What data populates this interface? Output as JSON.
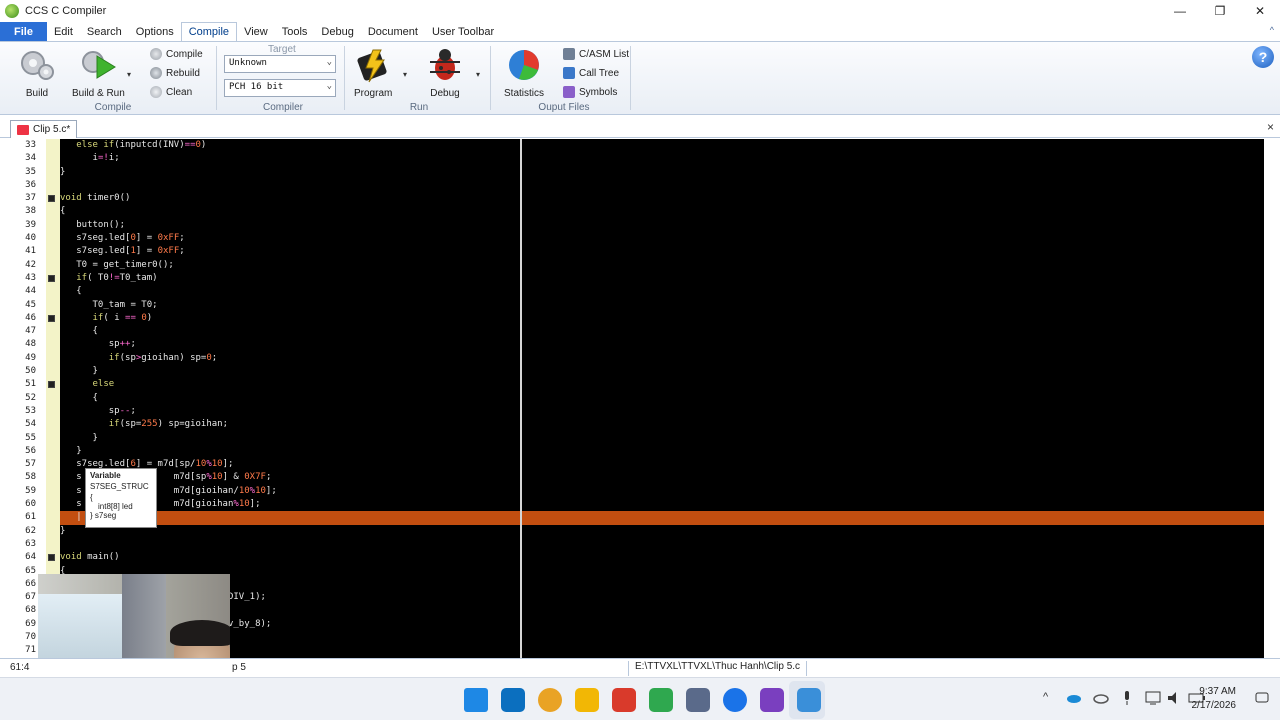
{
  "window": {
    "title": "CCS C Compiler",
    "minimize": "—",
    "maximize": "❐",
    "close": "✕"
  },
  "menu": {
    "tabs": [
      "File",
      "Edit",
      "Search",
      "Options",
      "Compile",
      "View",
      "Tools",
      "Debug",
      "Document",
      "User Toolbar"
    ],
    "active": "Compile",
    "help_collapse": "^"
  },
  "ribbon": {
    "compile_group": {
      "label": "Compile",
      "build": "Build",
      "build_run": "Build & Run",
      "compile": "Compile",
      "rebuild": "Rebuild",
      "clean": "Clean"
    },
    "compiler_group": {
      "label": "Compiler",
      "target_label": "Target",
      "target_value": "Unknown",
      "compiler_value": "PCH 16 bit"
    },
    "run_group": {
      "label": "Run",
      "program": "Program",
      "debug": "Debug"
    },
    "output_group": {
      "label": "Ouput Files",
      "statistics": "Statistics",
      "casm_list": "C/ASM List",
      "call_tree": "Call Tree",
      "symbols": "Symbols"
    },
    "help": "?"
  },
  "document": {
    "tab": "Clip 5.c*",
    "close": "×"
  },
  "editor": {
    "lines": [
      {
        "n": "33",
        "fold": false,
        "tokens": [
          [
            "kw",
            "   else "
          ],
          [
            "kw",
            "if"
          ],
          [
            "txt",
            "(inputcd(INV)"
          ],
          [
            "op",
            "=="
          ],
          [
            "num",
            "0"
          ],
          [
            "txt",
            ")"
          ]
        ]
      },
      {
        "n": "34",
        "fold": false,
        "tokens": [
          [
            "txt",
            "      i"
          ],
          [
            "op",
            "=!"
          ],
          [
            "txt",
            "i;"
          ]
        ]
      },
      {
        "n": "35",
        "fold": false,
        "tokens": [
          [
            "txt",
            "}"
          ]
        ]
      },
      {
        "n": "36",
        "fold": false,
        "tokens": []
      },
      {
        "n": "37",
        "fold": true,
        "tokens": [
          [
            "kw",
            "void "
          ],
          [
            "txt",
            "timer0()"
          ]
        ]
      },
      {
        "n": "38",
        "fold": false,
        "tokens": [
          [
            "txt",
            "{"
          ]
        ]
      },
      {
        "n": "39",
        "fold": false,
        "tokens": [
          [
            "txt",
            "   button();"
          ]
        ]
      },
      {
        "n": "40",
        "fold": false,
        "tokens": [
          [
            "txt",
            "   s7seg.led["
          ],
          [
            "num",
            "0"
          ],
          [
            "txt",
            "] = "
          ],
          [
            "num",
            "0xFF"
          ],
          [
            "txt",
            ";"
          ]
        ]
      },
      {
        "n": "41",
        "fold": false,
        "tokens": [
          [
            "txt",
            "   s7seg.led["
          ],
          [
            "num",
            "1"
          ],
          [
            "txt",
            "] = "
          ],
          [
            "num",
            "0xFF"
          ],
          [
            "txt",
            ";"
          ]
        ]
      },
      {
        "n": "42",
        "fold": false,
        "tokens": [
          [
            "txt",
            "   T0 = get_timer0();"
          ]
        ]
      },
      {
        "n": "43",
        "fold": true,
        "tokens": [
          [
            "kw",
            "   if"
          ],
          [
            "txt",
            "( T0"
          ],
          [
            "op",
            "!="
          ],
          [
            "txt",
            "T0_tam)"
          ]
        ]
      },
      {
        "n": "44",
        "fold": false,
        "tokens": [
          [
            "txt",
            "   {"
          ]
        ]
      },
      {
        "n": "45",
        "fold": false,
        "tokens": [
          [
            "txt",
            "      T0_tam = T0;"
          ]
        ]
      },
      {
        "n": "46",
        "fold": true,
        "tokens": [
          [
            "kw",
            "      if"
          ],
          [
            "txt",
            "( i "
          ],
          [
            "op",
            "=="
          ],
          [
            "txt",
            " "
          ],
          [
            "num",
            "0"
          ],
          [
            "txt",
            ")"
          ]
        ]
      },
      {
        "n": "47",
        "fold": false,
        "tokens": [
          [
            "txt",
            "      {"
          ]
        ]
      },
      {
        "n": "48",
        "fold": false,
        "tokens": [
          [
            "txt",
            "         sp"
          ],
          [
            "op",
            "++"
          ],
          [
            "txt",
            ";"
          ]
        ]
      },
      {
        "n": "49",
        "fold": false,
        "tokens": [
          [
            "kw",
            "         if"
          ],
          [
            "txt",
            "(sp"
          ],
          [
            "op",
            ">"
          ],
          [
            "txt",
            "gioihan) sp="
          ],
          [
            "num",
            "0"
          ],
          [
            "txt",
            ";"
          ]
        ]
      },
      {
        "n": "50",
        "fold": false,
        "tokens": [
          [
            "txt",
            "      }"
          ]
        ]
      },
      {
        "n": "51",
        "fold": true,
        "tokens": [
          [
            "kw",
            "      else"
          ]
        ]
      },
      {
        "n": "52",
        "fold": false,
        "tokens": [
          [
            "txt",
            "      {"
          ]
        ]
      },
      {
        "n": "53",
        "fold": false,
        "tokens": [
          [
            "txt",
            "         sp"
          ],
          [
            "op",
            "--"
          ],
          [
            "txt",
            ";"
          ]
        ]
      },
      {
        "n": "54",
        "fold": false,
        "tokens": [
          [
            "kw",
            "         if"
          ],
          [
            "txt",
            "(sp="
          ],
          [
            "num",
            "255"
          ],
          [
            "txt",
            ") sp=gioihan;"
          ]
        ]
      },
      {
        "n": "55",
        "fold": false,
        "tokens": [
          [
            "txt",
            "      }"
          ]
        ]
      },
      {
        "n": "56",
        "fold": false,
        "tokens": [
          [
            "txt",
            "   }"
          ]
        ]
      },
      {
        "n": "57",
        "fold": false,
        "tokens": [
          [
            "txt",
            "   s7seg.led["
          ],
          [
            "num",
            "6"
          ],
          [
            "txt",
            "] = m7d[sp/"
          ],
          [
            "num",
            "10"
          ],
          [
            "op",
            "%"
          ],
          [
            "num",
            "10"
          ],
          [
            "txt",
            "];"
          ]
        ]
      },
      {
        "n": "58",
        "fold": false,
        "tokens": [
          [
            "txt",
            "   s                 m7d[sp"
          ],
          [
            "op",
            "%"
          ],
          [
            "num",
            "10"
          ],
          [
            "txt",
            "] & "
          ],
          [
            "num",
            "0X7F"
          ],
          [
            "txt",
            ";"
          ]
        ]
      },
      {
        "n": "59",
        "fold": false,
        "tokens": [
          [
            "txt",
            "   s                 m7d[gioihan/"
          ],
          [
            "num",
            "10"
          ],
          [
            "op",
            "%"
          ],
          [
            "num",
            "10"
          ],
          [
            "txt",
            "];"
          ]
        ]
      },
      {
        "n": "60",
        "fold": false,
        "tokens": [
          [
            "txt",
            "   s                 m7d[gioihan"
          ],
          [
            "op",
            "%"
          ],
          [
            "num",
            "10"
          ],
          [
            "txt",
            "];"
          ]
        ]
      },
      {
        "n": "61",
        "fold": false,
        "current": true,
        "tokens": [
          [
            "txt",
            "   |"
          ]
        ]
      },
      {
        "n": "62",
        "fold": false,
        "tokens": [
          [
            "txt",
            "}"
          ]
        ]
      },
      {
        "n": "63",
        "fold": false,
        "tokens": []
      },
      {
        "n": "64",
        "fold": true,
        "tokens": [
          [
            "kw",
            "void "
          ],
          [
            "txt",
            "main()"
          ]
        ]
      },
      {
        "n": "65",
        "fold": false,
        "tokens": [
          [
            "txt",
            "{"
          ]
        ]
      },
      {
        "n": "66",
        "fold": false,
        "tokens": []
      },
      {
        "n": "67",
        "fold": false,
        "tokens": [
          [
            "txt",
            "                          L|T0_DIV_1);"
          ]
        ]
      },
      {
        "n": "68",
        "fold": false,
        "tokens": []
      },
      {
        "n": "69",
        "fold": false,
        "tokens": [
          [
            "txt",
            "                          T1_div_by_8);"
          ]
        ]
      },
      {
        "n": "70",
        "fold": false,
        "tokens": []
      },
      {
        "n": "71",
        "fold": false,
        "tokens": [
          [
            "txt",
            "                          R1);"
          ]
        ]
      }
    ]
  },
  "tooltip": {
    "title": "Variable",
    "type": "S7SEG_STRUC",
    "open": "{",
    "member": "int8[8]  led",
    "close": "} s7seg"
  },
  "status": {
    "position": "61:4",
    "file": "p 5",
    "path": "E:\\TTVXL\\TTVXL\\Thuc Hanh\\Clip 5.c"
  },
  "taskbar": {
    "clock_time": "9:37 AM",
    "clock_date": "2/17/2026",
    "app_colors": [
      "#1e88e5",
      "#0b6fbf",
      "#e9a325",
      "#f2b705",
      "#d93a2b",
      "#2fa84f",
      "#5a6a8a",
      "#1a73e8",
      "#7a3fbf",
      "#3a8fd9"
    ],
    "tray_expand": "^"
  }
}
